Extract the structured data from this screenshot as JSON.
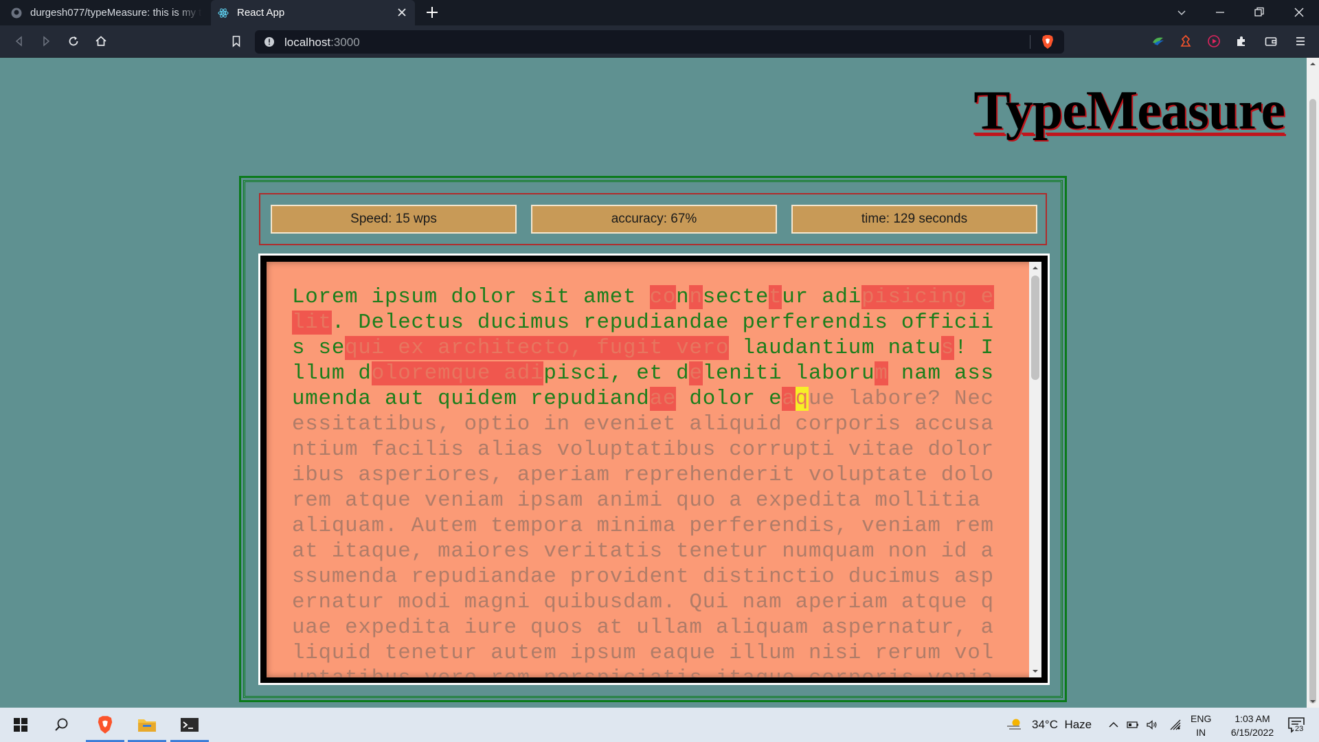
{
  "browser": {
    "tabs": [
      {
        "title": "durgesh077/typeMeasure: this is my typ",
        "icon": "github-icon"
      },
      {
        "title": "React App",
        "icon": "react-icon"
      }
    ],
    "url_host": "localhost",
    "url_port": ":3000"
  },
  "page": {
    "title": "TypeMeasure",
    "stats": {
      "speed": "Speed: 15 wps",
      "accuracy": "accuracy: 67%",
      "time": "time: 129 seconds"
    },
    "colors": {
      "background": "#5f9191",
      "text_area": "#fb9a76",
      "correct": "#1b7e1b",
      "wrong_highlight": "#f0574e",
      "cursor": "#f7ef27",
      "remaining": "#b07c68"
    },
    "typing_segments": [
      {
        "t": "c",
        "s": "Lorem ipsum dolor sit amet "
      },
      {
        "t": "w",
        "s": "co"
      },
      {
        "t": "c",
        "s": "n"
      },
      {
        "t": "w",
        "s": "n"
      },
      {
        "t": "c",
        "s": "secte"
      },
      {
        "t": "w",
        "s": "t"
      },
      {
        "t": "c",
        "s": "ur adi"
      },
      {
        "t": "w",
        "s": "pisicing elit"
      },
      {
        "t": "c",
        "s": ". Delectus ducimus repudiandae perferendis officiis se"
      },
      {
        "t": "w",
        "s": "qui ex architecto, fugit vero"
      },
      {
        "t": "c",
        "s": " laudantium natu"
      },
      {
        "t": "w",
        "s": "s"
      },
      {
        "t": "c",
        "s": "! Illum d"
      },
      {
        "t": "w",
        "s": "oloremque adi"
      },
      {
        "t": "c",
        "s": "pisci, et d"
      },
      {
        "t": "w",
        "s": "e"
      },
      {
        "t": "c",
        "s": "leniti laboru"
      },
      {
        "t": "w",
        "s": "m"
      },
      {
        "t": "c",
        "s": " nam assumenda aut quidem repudiand"
      },
      {
        "t": "w",
        "s": "ae"
      },
      {
        "t": "c",
        "s": " dolor e"
      },
      {
        "t": "w",
        "s": "a"
      },
      {
        "t": "cur",
        "s": "q"
      },
      {
        "t": "r",
        "s": "ue labore? Necessitatibus, optio in eveniet aliquid corporis accusantium facilis alias voluptatibus corrupti vitae doloribus asperiores, aperiam reprehenderit voluptate dolorem atque veniam ipsam animi quo a expedita mollitia aliquam. Autem tempora minima perferendis, veniam rem at itaque, maiores veritatis tenetur numquam non id assumenda repudiandae provident distinctio ducimus aspernatur modi magni quibusdam. Qui nam aperiam atque quae expedita iure quos at ullam aliquam aspernatur, aliquid tenetur autem ipsum eaque illum nisi rerum voluptatibus vero rem perspiciatis itaque corporis veniam quidem vel. Fugiat deserunt tenetur laboriosam quis e"
      }
    ]
  },
  "taskbar": {
    "temperature": "34°C",
    "weather": "Haze",
    "lang_top": "ENG",
    "lang_bottom": "IN",
    "time": "1:03 AM",
    "date": "6/15/2022",
    "notification_count": "23"
  }
}
